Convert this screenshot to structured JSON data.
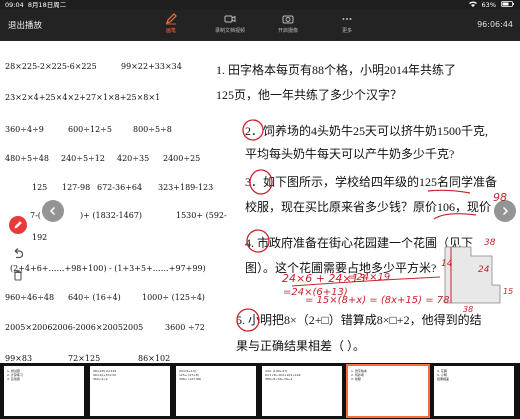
{
  "status_bar": {
    "time": "09:04",
    "date": "8月18日周二",
    "battery": "63%"
  },
  "toolbar": {
    "exit_label": "退出播放",
    "buttons": [
      {
        "label": "画笔",
        "icon": "pen-icon",
        "active": true
      },
      {
        "label": "录制文档视频",
        "icon": "video-icon",
        "active": false
      },
      {
        "label": "开启摄像",
        "icon": "camera-icon",
        "active": false
      },
      {
        "label": "更多",
        "icon": "more-icon",
        "active": false
      }
    ],
    "timer": "96:06:44"
  },
  "slide": {
    "math": [
      "28×225-2×225-6×225",
      "99×22+33×34",
      "23×2×4+25×4×2+27×1×8+25×8×1",
      "360÷4÷9",
      "600÷12÷5",
      "800÷5÷8",
      "480÷5÷48",
      "240÷5÷12",
      "420÷35",
      "2400÷25",
      "125",
      "127-98",
      "672-36+64",
      "323+189-123",
      "7-(",
      ")+ (1832-1467)",
      "1530+ (592-",
      "192",
      "(2+4+6+……+98+100) - (1+3+5+……+97+99)",
      "960÷46÷48",
      "640÷ (16÷4)",
      "1000÷ (125÷4)",
      "2005×20062006-2006×20052005",
      "3600 ÷72",
      "99×83",
      "72×125",
      "86×102"
    ],
    "questions": [
      "1.  田字格本每页有88个格，小明2014年共练了",
      "125页，他一年共练了多少个汉字？",
      "2．饲养场的4头奶牛25天可以挤牛奶1500千克,",
      "平均每头奶牛每天可以产牛奶多少千克?",
      "3．如下图所示，学校给四年级的125名同学准备",
      "校服，现在买比原来省多少钱？原价106，现价",
      "4. 市政府准备在街心花园建一个花圃（见下",
      "图）。这个花圃需要占地多少平方米?",
      "5. 小明把8×（2+□）错算成8×□+2，他得到的结",
      "果与正确结果相差（      ）。"
    ],
    "annotations": [
      "98",
      "24×6 + 24×13",
      "=24×(6+13)",
      "=24×19",
      "= 15×(8+x) = (8x+15) = 78",
      "14",
      "38",
      "24",
      "38",
      "15"
    ]
  },
  "thumbnails": [
    {
      "lines": [
        "1. 测试题",
        "2. 计算练习",
        "3. 应用题"
      ]
    },
    {
      "lines": [
        "28×225-2×225",
        "99×22+33×34",
        "360÷4÷9"
      ]
    },
    {
      "lines": [
        "24×(6+13)",
        "125+ (27+8)",
        "398+ (127-98)"
      ]
    },
    {
      "lines": [
        "344- (144+37)",
        "6×7×8÷102+102+104",
        "380÷8÷36÷39÷4"
      ]
    },
    {
      "lines": [
        "1. 田字格本",
        "2. 饲养场",
        "3. 校服"
      ]
    },
    {
      "lines": [
        "4. 花圃",
        "5. 小明",
        "结果相差"
      ]
    }
  ]
}
